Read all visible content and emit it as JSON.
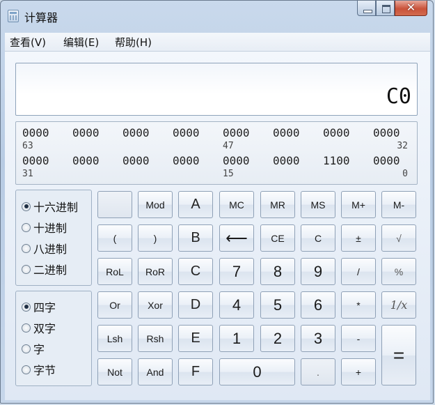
{
  "window": {
    "title": "计算器"
  },
  "menu": [
    "查看(V)",
    "编辑(E)",
    "帮助(H)"
  ],
  "display": {
    "value": "C0"
  },
  "binary": {
    "row1": [
      "0000",
      "0000",
      "0000",
      "0000",
      "0000",
      "0000",
      "0000",
      "0000"
    ],
    "row1_idx": [
      "63",
      "47",
      "32"
    ],
    "row2": [
      "0000",
      "0000",
      "0000",
      "0000",
      "0000",
      "0000",
      "1100",
      "0000"
    ],
    "row2_idx": [
      "31",
      "15",
      "0"
    ]
  },
  "base_modes": [
    {
      "label": "十六进制",
      "selected": true
    },
    {
      "label": "十进制",
      "selected": false
    },
    {
      "label": "八进制",
      "selected": false
    },
    {
      "label": "二进制",
      "selected": false
    }
  ],
  "word_sizes": [
    {
      "label": "四字",
      "selected": true
    },
    {
      "label": "双字",
      "selected": false
    },
    {
      "label": "字",
      "selected": false
    },
    {
      "label": "字节",
      "selected": false
    }
  ],
  "keys": {
    "mod": "Mod",
    "a": "A",
    "mc": "MC",
    "mr": "MR",
    "ms": "MS",
    "mplus": "M+",
    "mminus": "M-",
    "lparen": "(",
    "rparen": ")",
    "b": "B",
    "back": "⟵",
    "ce": "CE",
    "c": "C",
    "neg": "±",
    "sqrt": "√",
    "rol": "RoL",
    "ror": "RoR",
    "hexc": "C",
    "n7": "7",
    "n8": "8",
    "n9": "9",
    "div": "/",
    "pct": "%",
    "or": "Or",
    "xor": "Xor",
    "d": "D",
    "n4": "4",
    "n5": "5",
    "n6": "6",
    "mul": "*",
    "recip": "1/x",
    "lsh": "Lsh",
    "rsh": "Rsh",
    "e": "E",
    "n1": "1",
    "n2": "2",
    "n3": "3",
    "sub": "-",
    "eq": "=",
    "not": "Not",
    "and": "And",
    "f": "F",
    "n0": "0",
    "dot": ".",
    "add": "+"
  }
}
